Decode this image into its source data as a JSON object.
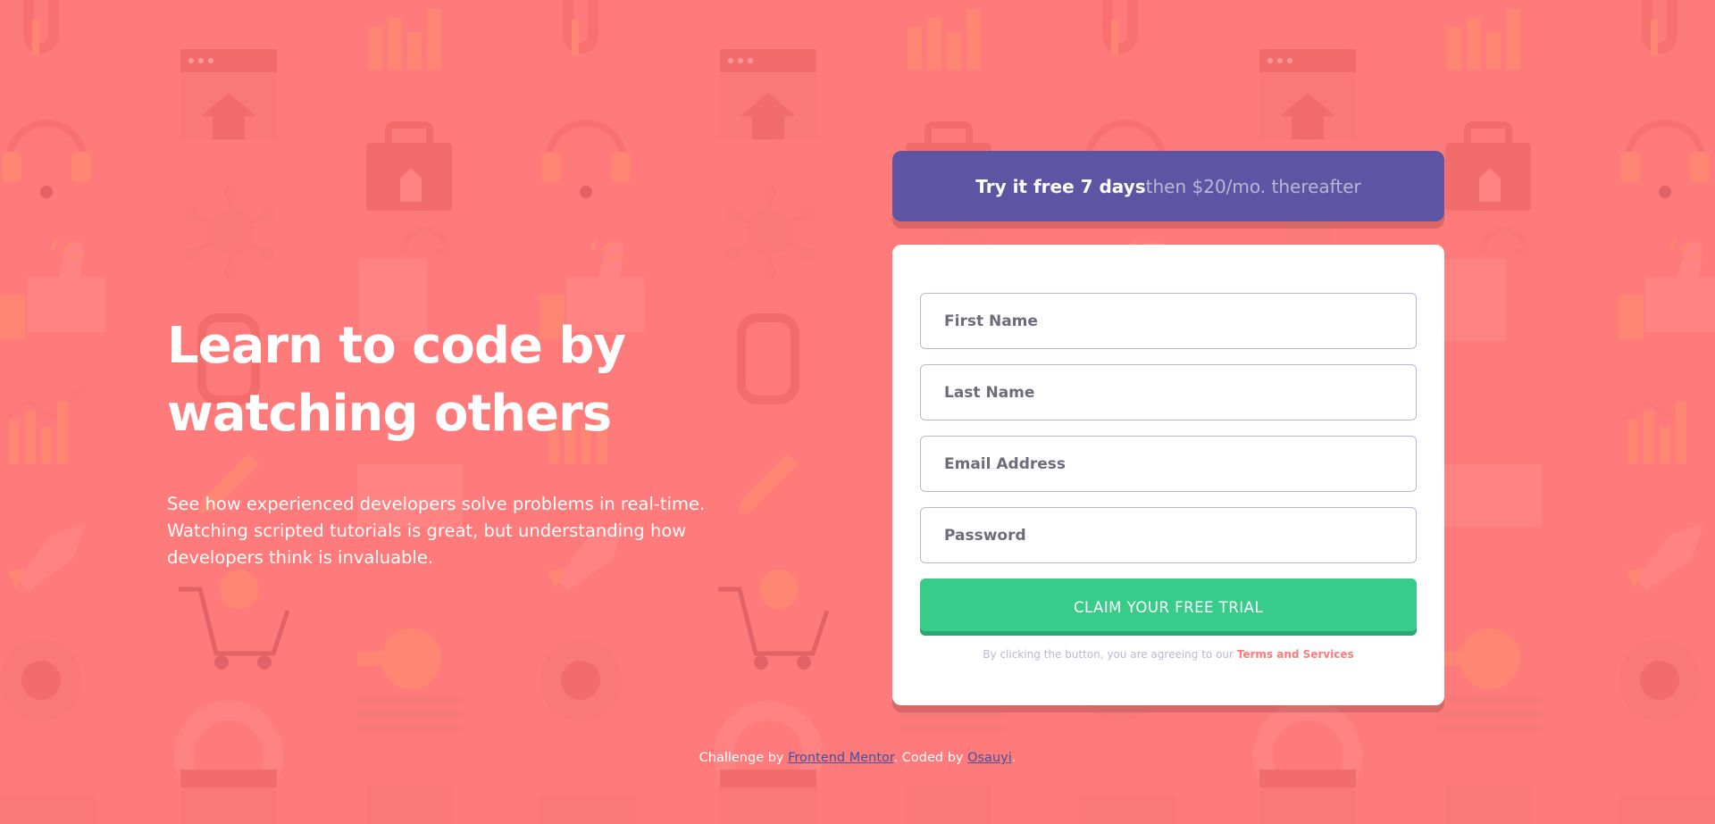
{
  "colors": {
    "background": "#ff7a7a",
    "banner": "#5e54a4",
    "cta": "#38cc8b",
    "accent": "#ff7a7a",
    "field_border": "#b9b6d3",
    "muted": "#bab7d4",
    "link": "#3e52a3"
  },
  "hero": {
    "title_line1": "Learn to code by",
    "title_line2": "watching others",
    "description_line1": "See how experienced developers solve problems in real-time.",
    "description_line2": "Watching scripted tutorials is great, but understanding how",
    "description_line3": "developers think is invaluable."
  },
  "promo": {
    "strong": "Try it free 7 days",
    "rest": "then $20/mo. thereafter"
  },
  "form": {
    "first_name_placeholder": "First Name",
    "last_name_placeholder": "Last Name",
    "email_placeholder": "Email Address",
    "password_placeholder": "Password",
    "submit_label": "CLAIM YOUR FREE TRIAL",
    "terms_text": "By clicking the button, you are agreeing to our",
    "terms_link": "Terms and Services"
  },
  "footer": {
    "challenge_by": "Challenge by",
    "frontend_mentor_link": "Frontend Mentor",
    "coded_by": ". Coded by",
    "author_link": "Osauyi",
    "end": "."
  },
  "background_icons": [
    "link-icon",
    "bar-chart-icon",
    "browser-window-icon",
    "headset-icon",
    "toolbox-icon",
    "network-icon",
    "thumbs-up-icon",
    "pencil-note-icon",
    "rocket-icon",
    "cart-icon",
    "key-icon",
    "lifebuoy-icon",
    "globe-gear-icon",
    "calendar-icon"
  ]
}
